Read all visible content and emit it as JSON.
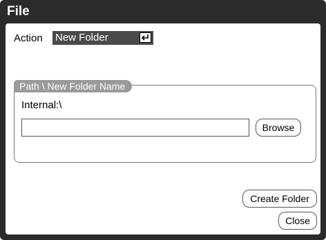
{
  "window": {
    "title": "File"
  },
  "action": {
    "label": "Action",
    "value": "New Folder",
    "enter_icon": "enter-icon"
  },
  "path_group": {
    "heading": "Path \\ New Folder Name",
    "path": "Internal:\\",
    "folder_name_value": "",
    "browse_label": "Browse"
  },
  "buttons": {
    "create_label": "Create Folder",
    "close_label": "Close"
  },
  "colors": {
    "frame": "#2b2b2b",
    "select_bg": "#4a4a4a",
    "group_tab": "#9a9a9a"
  }
}
